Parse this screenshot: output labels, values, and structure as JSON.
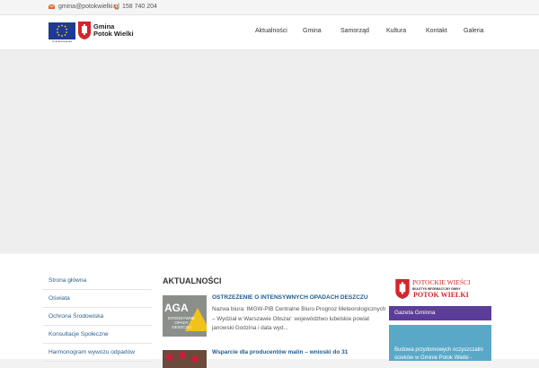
{
  "topbar": {
    "email": "gmina@potokwielki.pl",
    "phone": "158 740 204",
    "accent_color": "#e0662a"
  },
  "header": {
    "eu_caption": "Unia Europejska",
    "logo_line1": "Gmina",
    "logo_line2": "Potok Wielki",
    "nav": [
      "Aktualności",
      "Gmina",
      "Samorząd",
      "Kultura",
      "Kontakt",
      "Galeria"
    ]
  },
  "sidebar": {
    "items": [
      "Strona główna",
      "Oświata",
      "Ochrona Środowiska",
      "Konsultacje Społeczne",
      "Harmonogram wywozu odpadów"
    ]
  },
  "news": {
    "section_title": "AKTUALNOŚCI",
    "items": [
      {
        "title": "OSTRZEŻENIE O INTENSYWNYCH OPADACH DESZCZU",
        "text": "Nazwa biura: IMGW-PIB Centralne Biuro Prognoz Meteorologicznych – Wydział w Warszawie Obszar: województwo lubelskie powiat janowski Godzina i data wyd...",
        "thumb_big": "AGA",
        "thumb_small": "INTENSYWNE OPADY DESZCZU"
      },
      {
        "title": "Wsparcie dla producentów malin – wnioski do 31"
      }
    ]
  },
  "right": {
    "pw_title": "POTOCKIE WIEŚCI",
    "pw_sub": "BIULETYN INFORMACYJNY GMINY",
    "pw_big": "POTOK WIELKI",
    "gazeta": "Gazeta Gminna",
    "promo_text": "Budowa przydomowych oczyszczalni ścieków w Gminie Potok Wielki -"
  }
}
